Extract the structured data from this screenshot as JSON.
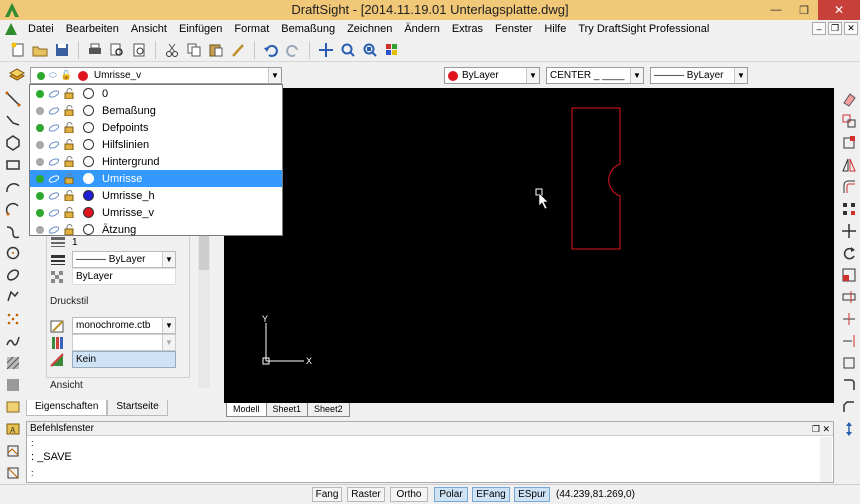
{
  "window": {
    "app_name": "DraftSight",
    "title": "DraftSight - [2014.11.19.01 Unterlagsplatte.dwg]",
    "minimize": "—",
    "restore": "❐",
    "close": "✕"
  },
  "menu": [
    "Datei",
    "Bearbeiten",
    "Ansicht",
    "Einfügen",
    "Format",
    "Bemaßung",
    "Zeichnen",
    "Ändern",
    "Extras",
    "Fenster",
    "Hilfe",
    "Try DraftSight Professional"
  ],
  "layer_combo": {
    "current": "Umrisse_v",
    "current_color": "#e0141e"
  },
  "layers": [
    {
      "name": "0",
      "on": true,
      "color": "#ffffff"
    },
    {
      "name": "Bemaßung",
      "on": false,
      "color": "#ffffff"
    },
    {
      "name": "Defpoints",
      "on": true,
      "color": "#ffffff"
    },
    {
      "name": "Hilfslinien",
      "on": false,
      "color": "#ffffff"
    },
    {
      "name": "Hintergrund",
      "on": false,
      "color": "#ffffff"
    },
    {
      "name": "Umrisse",
      "on": true,
      "color": "#ffffff",
      "selected": true
    },
    {
      "name": "Umrisse_h",
      "on": true,
      "color": "#1f1fd6"
    },
    {
      "name": "Umrisse_v",
      "on": true,
      "color": "#e0141e"
    },
    {
      "name": "Ätzung",
      "on": false,
      "color": "#ffffff"
    }
  ],
  "color_combo": {
    "value": "ByLayer",
    "color": "#e0141e"
  },
  "linetype_combo": {
    "value": "CENTER  _  ____"
  },
  "lineweight_combo": {
    "value": "——— ByLayer"
  },
  "properties": {
    "lineweight_scale": "1",
    "linestyle": "——— ByLayer",
    "transparency": "ByLayer",
    "druckstil_label": "Druckstil",
    "plot_table": "monochrome.ctb",
    "plot_style": "",
    "plot_style_value": "Kein",
    "ansicht_label": "Ansicht"
  },
  "panel_tabs": [
    "Eigenschaften",
    "Startseite"
  ],
  "sheet_tabs": [
    "Modell",
    "Sheet1",
    "Sheet2"
  ],
  "command": {
    "title": "Befehlsfenster",
    "prompt_line1": ":",
    "prompt_line2": ": _SAVE",
    "prompt_line3": ":"
  },
  "ucs": {
    "x_label": "X",
    "y_label": "Y"
  },
  "status_buttons": [
    {
      "label": "Fang",
      "on": false
    },
    {
      "label": "Raster",
      "on": false
    },
    {
      "label": "Ortho",
      "on": false
    },
    {
      "label": "Polar",
      "on": true
    },
    {
      "label": "EFang",
      "on": true
    },
    {
      "label": "ESpur",
      "on": true
    }
  ],
  "coordinates": "(44.239,81.269,0)"
}
